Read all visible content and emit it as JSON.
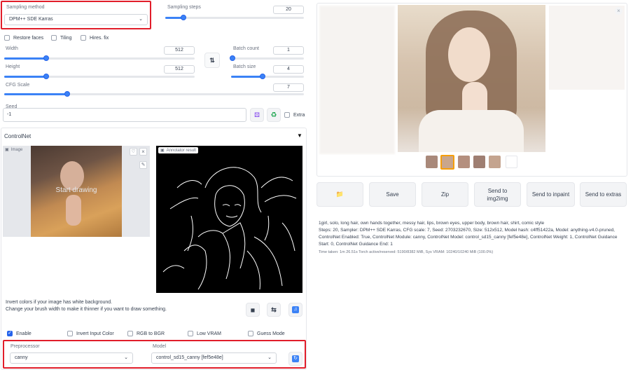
{
  "sampling": {
    "method_label": "Sampling method",
    "method_value": "DPM++ SDE Karras",
    "steps_label": "Sampling steps",
    "steps_value": "20",
    "steps_fraction": 0.13
  },
  "options": {
    "restore_faces": "Restore faces",
    "tiling": "Tiling",
    "hires_fix": "Hires. fix"
  },
  "width": {
    "label": "Width",
    "value": "512",
    "fraction": 0.2
  },
  "height": {
    "label": "Height",
    "value": "512",
    "fraction": 0.2
  },
  "batch_count": {
    "label": "Batch count",
    "value": "1",
    "fraction": 0.0
  },
  "batch_size": {
    "label": "Batch size",
    "value": "4",
    "fraction": 0.43
  },
  "cfg": {
    "label": "CFG Scale",
    "value": "7",
    "fraction": 0.22
  },
  "seed": {
    "label": "Seed",
    "value": "-1",
    "extra": "Extra"
  },
  "controlnet": {
    "title": "ControlNet",
    "image_label": "Image",
    "overlay_text": "Start drawing",
    "annotator_label": "Annotator result",
    "hint_line1": "Invert colors if your image has white background.",
    "hint_line2": "Change your brush width to make it thinner if you want to draw something.",
    "enable": "Enable",
    "invert_input": "Invert Input Color",
    "rgb_to_bgr": "RGB to BGR",
    "low_vram": "Low VRAM",
    "guess_mode": "Guess Mode",
    "preprocessor_label": "Preprocessor",
    "preprocessor_value": "canny",
    "model_label": "Model",
    "model_value": "control_sd15_canny [fef5e48e]"
  },
  "actions": {
    "folder": "📁",
    "save": "Save",
    "zip": "Zip",
    "send_img2img_1": "Send to",
    "send_img2img_2": "img2img",
    "send_inpaint": "Send to inpaint",
    "send_extras": "Send to extras"
  },
  "info": {
    "prompt": "1girl, solo, long hair, own hands together, messy hair, lips, brown eyes, upper body, brown hair, shirt, comic style",
    "params": "Steps: 20, Sampler: DPM++ SDE Karras, CFG scale: 7, Seed: 2703232670, Size: 512x512, Model hash: c4ff51422a, Model: anything-v4.0-pruned, ControlNet Enabled: True, ControlNet Module: canny, ControlNet Model: control_sd15_canny [fef5e48e], ControlNet Weight: 1, ControlNet Guidance Start: 0, ControlNet Guidance End: 1",
    "time": "Time taken: 1m 26.51s  Torch active/reserved: 5190/8382 MiB, Sys VRAM: 10240/10240 MiB (100.0%)"
  },
  "colors": {
    "accent": "#3b82f6",
    "highlight": "#e11d2a",
    "canny_bg": "#000000"
  }
}
